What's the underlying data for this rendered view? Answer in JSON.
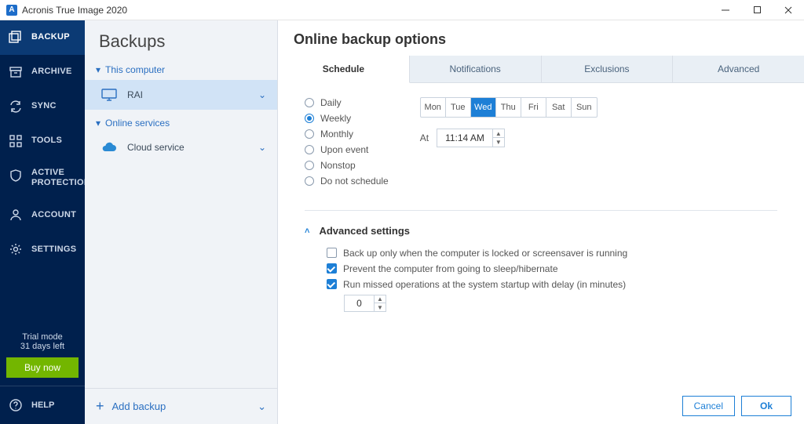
{
  "titlebar": {
    "app_name": "Acronis True Image 2020"
  },
  "sidebar": {
    "items": [
      {
        "label": "BACKUP"
      },
      {
        "label": "ARCHIVE"
      },
      {
        "label": "SYNC"
      },
      {
        "label": "TOOLS"
      },
      {
        "label": "ACTIVE\nPROTECTION"
      },
      {
        "label": "ACCOUNT"
      },
      {
        "label": "SETTINGS"
      }
    ],
    "trial_line1": "Trial mode",
    "trial_line2": "31 days left",
    "buy_label": "Buy now",
    "help_label": "HELP"
  },
  "list": {
    "header": "Backups",
    "group1": "This computer",
    "item1": "RAI",
    "group2": "Online services",
    "item2": "Cloud service",
    "add_label": "Add backup"
  },
  "main": {
    "title": "Online backup options",
    "tabs": [
      "Schedule",
      "Notifications",
      "Exclusions",
      "Advanced"
    ],
    "frequency": {
      "options": [
        "Daily",
        "Weekly",
        "Monthly",
        "Upon event",
        "Nonstop",
        "Do not schedule"
      ],
      "selected_index": 1
    },
    "days": [
      "Mon",
      "Tue",
      "Wed",
      "Thu",
      "Fri",
      "Sat",
      "Sun"
    ],
    "selected_day_index": 2,
    "at_label": "At",
    "time_value": "11:14 AM",
    "advanced_header": "Advanced settings",
    "adv_opts": [
      {
        "label": "Back up only when the computer is locked or screensaver is running",
        "checked": false
      },
      {
        "label": "Prevent the computer from going to sleep/hibernate",
        "checked": true
      },
      {
        "label": "Run missed operations at the system startup with delay (in minutes)",
        "checked": true
      }
    ],
    "delay_value": "0",
    "cancel_label": "Cancel",
    "ok_label": "Ok"
  }
}
